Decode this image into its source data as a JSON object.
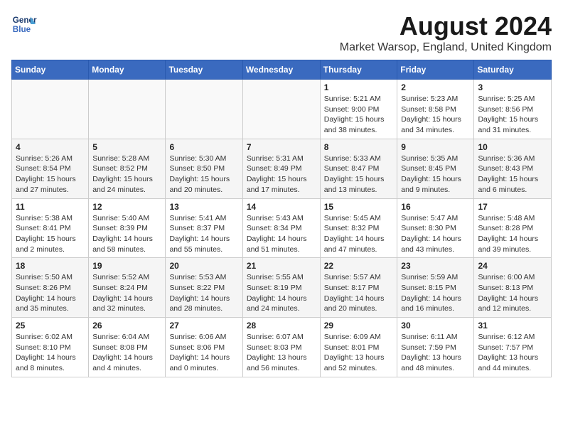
{
  "header": {
    "logo_line1": "General",
    "logo_line2": "Blue",
    "title": "August 2024",
    "subtitle": "Market Warsop, England, United Kingdom"
  },
  "days_of_week": [
    "Sunday",
    "Monday",
    "Tuesday",
    "Wednesday",
    "Thursday",
    "Friday",
    "Saturday"
  ],
  "weeks": [
    [
      {
        "day": "",
        "info": ""
      },
      {
        "day": "",
        "info": ""
      },
      {
        "day": "",
        "info": ""
      },
      {
        "day": "",
        "info": ""
      },
      {
        "day": "1",
        "info": "Sunrise: 5:21 AM\nSunset: 9:00 PM\nDaylight: 15 hours\nand 38 minutes."
      },
      {
        "day": "2",
        "info": "Sunrise: 5:23 AM\nSunset: 8:58 PM\nDaylight: 15 hours\nand 34 minutes."
      },
      {
        "day": "3",
        "info": "Sunrise: 5:25 AM\nSunset: 8:56 PM\nDaylight: 15 hours\nand 31 minutes."
      }
    ],
    [
      {
        "day": "4",
        "info": "Sunrise: 5:26 AM\nSunset: 8:54 PM\nDaylight: 15 hours\nand 27 minutes."
      },
      {
        "day": "5",
        "info": "Sunrise: 5:28 AM\nSunset: 8:52 PM\nDaylight: 15 hours\nand 24 minutes."
      },
      {
        "day": "6",
        "info": "Sunrise: 5:30 AM\nSunset: 8:50 PM\nDaylight: 15 hours\nand 20 minutes."
      },
      {
        "day": "7",
        "info": "Sunrise: 5:31 AM\nSunset: 8:49 PM\nDaylight: 15 hours\nand 17 minutes."
      },
      {
        "day": "8",
        "info": "Sunrise: 5:33 AM\nSunset: 8:47 PM\nDaylight: 15 hours\nand 13 minutes."
      },
      {
        "day": "9",
        "info": "Sunrise: 5:35 AM\nSunset: 8:45 PM\nDaylight: 15 hours\nand 9 minutes."
      },
      {
        "day": "10",
        "info": "Sunrise: 5:36 AM\nSunset: 8:43 PM\nDaylight: 15 hours\nand 6 minutes."
      }
    ],
    [
      {
        "day": "11",
        "info": "Sunrise: 5:38 AM\nSunset: 8:41 PM\nDaylight: 15 hours\nand 2 minutes."
      },
      {
        "day": "12",
        "info": "Sunrise: 5:40 AM\nSunset: 8:39 PM\nDaylight: 14 hours\nand 58 minutes."
      },
      {
        "day": "13",
        "info": "Sunrise: 5:41 AM\nSunset: 8:37 PM\nDaylight: 14 hours\nand 55 minutes."
      },
      {
        "day": "14",
        "info": "Sunrise: 5:43 AM\nSunset: 8:34 PM\nDaylight: 14 hours\nand 51 minutes."
      },
      {
        "day": "15",
        "info": "Sunrise: 5:45 AM\nSunset: 8:32 PM\nDaylight: 14 hours\nand 47 minutes."
      },
      {
        "day": "16",
        "info": "Sunrise: 5:47 AM\nSunset: 8:30 PM\nDaylight: 14 hours\nand 43 minutes."
      },
      {
        "day": "17",
        "info": "Sunrise: 5:48 AM\nSunset: 8:28 PM\nDaylight: 14 hours\nand 39 minutes."
      }
    ],
    [
      {
        "day": "18",
        "info": "Sunrise: 5:50 AM\nSunset: 8:26 PM\nDaylight: 14 hours\nand 35 minutes."
      },
      {
        "day": "19",
        "info": "Sunrise: 5:52 AM\nSunset: 8:24 PM\nDaylight: 14 hours\nand 32 minutes."
      },
      {
        "day": "20",
        "info": "Sunrise: 5:53 AM\nSunset: 8:22 PM\nDaylight: 14 hours\nand 28 minutes."
      },
      {
        "day": "21",
        "info": "Sunrise: 5:55 AM\nSunset: 8:19 PM\nDaylight: 14 hours\nand 24 minutes."
      },
      {
        "day": "22",
        "info": "Sunrise: 5:57 AM\nSunset: 8:17 PM\nDaylight: 14 hours\nand 20 minutes."
      },
      {
        "day": "23",
        "info": "Sunrise: 5:59 AM\nSunset: 8:15 PM\nDaylight: 14 hours\nand 16 minutes."
      },
      {
        "day": "24",
        "info": "Sunrise: 6:00 AM\nSunset: 8:13 PM\nDaylight: 14 hours\nand 12 minutes."
      }
    ],
    [
      {
        "day": "25",
        "info": "Sunrise: 6:02 AM\nSunset: 8:10 PM\nDaylight: 14 hours\nand 8 minutes."
      },
      {
        "day": "26",
        "info": "Sunrise: 6:04 AM\nSunset: 8:08 PM\nDaylight: 14 hours\nand 4 minutes."
      },
      {
        "day": "27",
        "info": "Sunrise: 6:06 AM\nSunset: 8:06 PM\nDaylight: 14 hours\nand 0 minutes."
      },
      {
        "day": "28",
        "info": "Sunrise: 6:07 AM\nSunset: 8:03 PM\nDaylight: 13 hours\nand 56 minutes."
      },
      {
        "day": "29",
        "info": "Sunrise: 6:09 AM\nSunset: 8:01 PM\nDaylight: 13 hours\nand 52 minutes."
      },
      {
        "day": "30",
        "info": "Sunrise: 6:11 AM\nSunset: 7:59 PM\nDaylight: 13 hours\nand 48 minutes."
      },
      {
        "day": "31",
        "info": "Sunrise: 6:12 AM\nSunset: 7:57 PM\nDaylight: 13 hours\nand 44 minutes."
      }
    ]
  ]
}
